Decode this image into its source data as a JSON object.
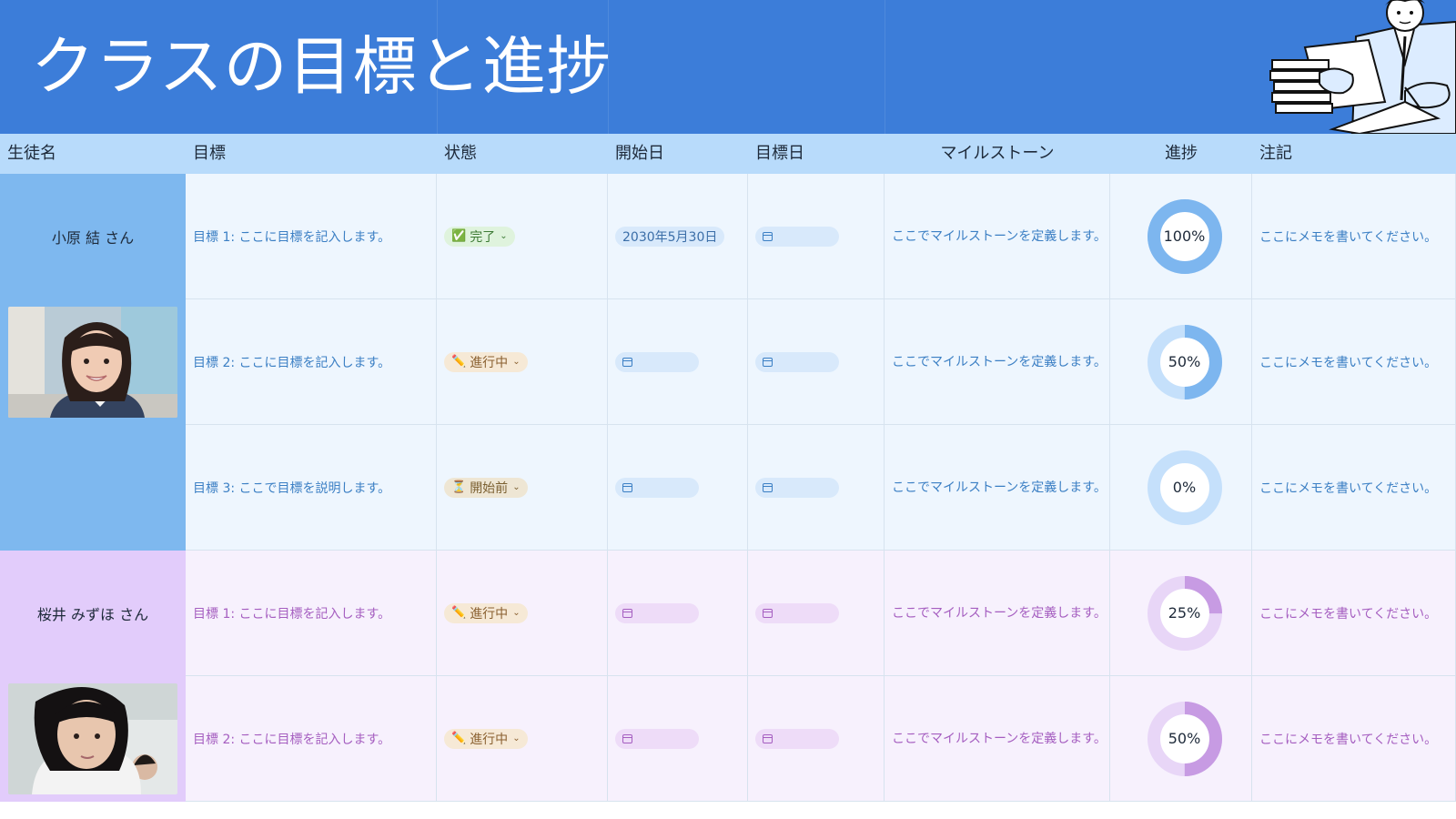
{
  "title": "クラスの目標と進捗",
  "columns": [
    "生徒名",
    "目標",
    "状態",
    "開始日",
    "目標日",
    "マイルストーン",
    "進捗",
    "注記"
  ],
  "rows": [
    {
      "student": "小原 結 さん",
      "group": "blue",
      "name_kind": "text",
      "goal": "目標 1: ここに目標を記入します。",
      "status": "完了",
      "status_icon": "check-box-icon",
      "start_date": "2030年5月30日",
      "target_date": "",
      "milestone": "ここでマイルストーンを定義します。",
      "progress": 100,
      "progress_label": "100%",
      "note": "ここにメモを書いてください。"
    },
    {
      "student": "",
      "group": "blue",
      "name_kind": "photo",
      "goal": "目標 2: ここに目標を記入します。",
      "status": "進行中",
      "status_icon": "pencil-icon",
      "start_date": "",
      "target_date": "",
      "milestone": "ここでマイルストーンを定義します。",
      "progress": 50,
      "progress_label": "50%",
      "note": "ここにメモを書いてください。"
    },
    {
      "student": "",
      "group": "blue",
      "name_kind": "empty",
      "goal": "目標 3: ここで目標を説明します。",
      "status": "開始前",
      "status_icon": "hourglass-icon",
      "start_date": "",
      "target_date": "",
      "milestone": "ここでマイルストーンを定義します。",
      "progress": 0,
      "progress_label": "0%",
      "note": "ここにメモを書いてください。"
    },
    {
      "student": "桜井 みずほ さん",
      "group": "purple",
      "name_kind": "text",
      "goal": "目標 1: ここに目標を記入します。",
      "status": "進行中",
      "status_icon": "pencil-icon",
      "start_date": "",
      "target_date": "",
      "milestone": "ここでマイルストーンを定義します。",
      "progress": 25,
      "progress_label": "25%",
      "note": "ここにメモを書いてください。"
    },
    {
      "student": "",
      "group": "purple",
      "name_kind": "photo",
      "goal": "目標 2: ここに目標を記入します。",
      "status": "進行中",
      "status_icon": "pencil-icon",
      "start_date": "",
      "target_date": "",
      "milestone": "ここでマイルストーンを定義します。",
      "progress": 50,
      "progress_label": "50%",
      "note": "ここにメモを書いてください。"
    }
  ],
  "colors": {
    "banner": "#3c7dd9",
    "header": "#b8dbfb",
    "blue_ring": "#7db6ef",
    "blue_ring_bg": "#c5e0fb",
    "purple_ring": "#c79be3",
    "purple_ring_bg": "#e8d6f7"
  }
}
